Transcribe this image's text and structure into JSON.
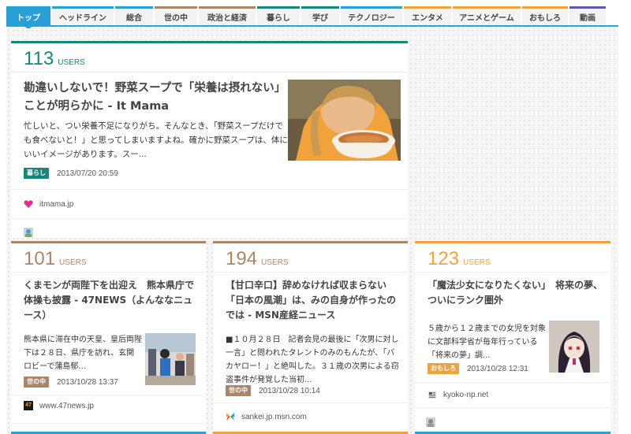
{
  "tabs": [
    {
      "label": "トップ",
      "active": true,
      "color": "#2aa0d8",
      "width": 56
    },
    {
      "label": "ヘッドライン",
      "active": false,
      "color": "#2aa0d8",
      "width": 78
    },
    {
      "label": "総合",
      "active": false,
      "color": "#2aa0d8",
      "width": 48
    },
    {
      "label": "世の中",
      "active": false,
      "color": "#a9866a",
      "width": 54
    },
    {
      "label": "政治と経済",
      "active": false,
      "color": "#a9866a",
      "width": 72
    },
    {
      "label": "暮らし",
      "active": false,
      "color": "#16887a",
      "width": 54
    },
    {
      "label": "学び",
      "active": false,
      "color": "#16887a",
      "width": 48
    },
    {
      "label": "テクノロジー",
      "active": false,
      "color": "#2aa0d8",
      "width": 78
    },
    {
      "label": "エンタメ",
      "active": false,
      "color": "#f0a33a",
      "width": 60
    },
    {
      "label": "アニメとゲーム",
      "active": false,
      "color": "#f0a33a",
      "width": 86
    },
    {
      "label": "おもしろ",
      "active": false,
      "color": "#f0a33a",
      "width": 58
    },
    {
      "label": "動画",
      "active": false,
      "color": "#5a5ab0",
      "width": 46
    }
  ],
  "featured": {
    "count": "113",
    "users_label": "USERS",
    "title": "勘違いしないで！野菜スープで「栄養は摂れない」ことが明らかに - It Mama",
    "excerpt": "忙しいと、つい栄養不足になりがち。そんなとき、「野菜スープだけでも食べないと！」と思ってしまいますよね。確かに野菜スープは、体にいいイメージがあります。スー...",
    "category": "暮らし",
    "category_color": "#16887a",
    "date": "2013/07/20 20:59",
    "source": "itmama.jp"
  },
  "cards": [
    {
      "count": "101",
      "users_label": "USERS",
      "title": "くまモンが両陛下を出迎え　熊本県庁で体操も披露 - 47NEWS（よんななニュース）",
      "excerpt": "熊本県に滞在中の天皇、皇后両陛下は２８日、県庁を訪れ、玄関ロビーで蒲島郁...",
      "category": "世の中",
      "category_color": "#a9866a",
      "date": "2013/10/28 13:37",
      "source": "www.47news.jp",
      "favicon_text": "47"
    },
    {
      "count": "194",
      "users_label": "USERS",
      "title": "【甘口辛口】辞めなければ収まらない「日本の風潮」は、みの自身が作ったのでは - MSN産経ニュース",
      "excerpt": "■１０月２８日　記者会見の最後に「次男に対し一言」と問われたタレントのみのもんたが、「バカヤロー！」と絶叫した。３１歳の次男による窃盗事件が発覚した当初...",
      "category": "世の中",
      "category_color": "#a9866a",
      "date": "2013/10/28 10:14",
      "source": "sankei.jp.msn.com"
    },
    {
      "count": "123",
      "users_label": "USERS",
      "title": "「魔法少女になりたくない」　将来の夢、ついにランク圏外",
      "excerpt": "５歳から１２歳までの女児を対象に文部科学省が毎年行っている「将来の夢」調...",
      "category": "おもしろ",
      "category_color": "#f0a33a",
      "date": "2013/10/28 12:31",
      "source": "kyoko-np.net"
    }
  ]
}
